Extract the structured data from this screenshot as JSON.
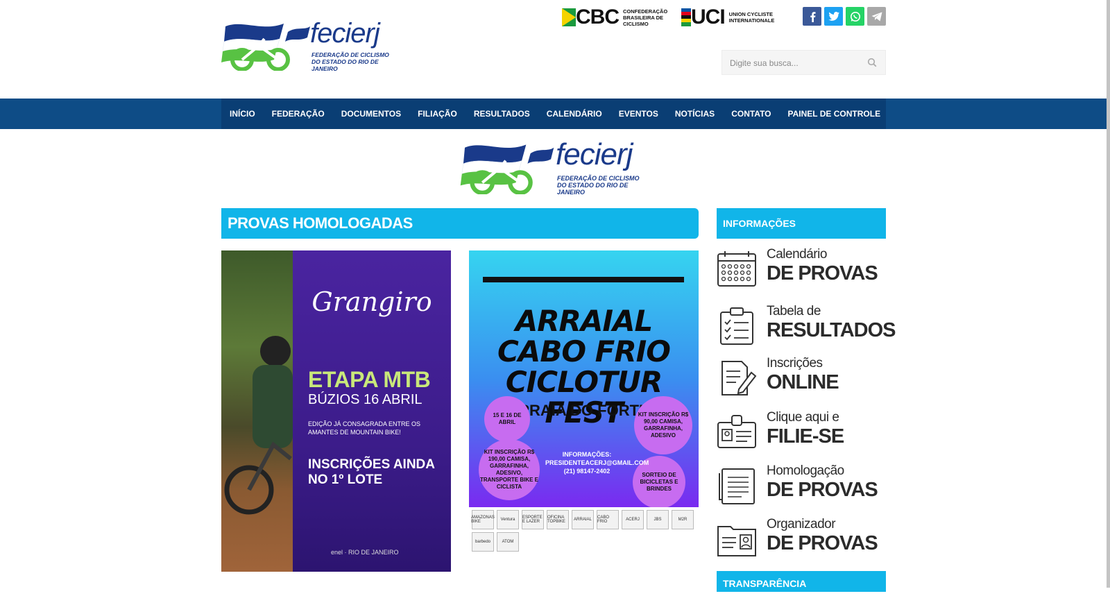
{
  "header": {
    "logo_name": "fecierj",
    "logo_subtitle": "FEDERAÇÃO DE CICLISMO DO ESTADO DO RIO DE JANEIRO",
    "partners": [
      {
        "mark": "CBC",
        "sub": "CONFEDERAÇÃO BRASILEIRA DE CICLISMO"
      },
      {
        "mark": "UCI",
        "sub": "UNION CYCLISTE INTERNATIONALE"
      }
    ],
    "social": [
      {
        "name": "facebook",
        "color": "#3b5998",
        "glyph": "f"
      },
      {
        "name": "twitter",
        "color": "#1da1f2",
        "glyph": "t"
      },
      {
        "name": "whatsapp",
        "color": "#25d366",
        "glyph": "w"
      },
      {
        "name": "telegram",
        "color": "#a8a8a8",
        "glyph": "tg"
      }
    ],
    "search": {
      "placeholder": "Digite sua busca..."
    }
  },
  "nav": {
    "items": [
      "INÍCIO",
      "FEDERAÇÃO",
      "DOCUMENTOS",
      "FILIAÇÃO",
      "RESULTADOS",
      "CALENDÁRIO",
      "EVENTOS",
      "NOTÍCIAS",
      "CONTATO",
      "PAINEL DE CONTROLE"
    ]
  },
  "center_logo": {
    "name": "fecierj",
    "subtitle": "FEDERAÇÃO DE CICLISMO DO ESTADO DO RIO DE JANEIRO"
  },
  "main": {
    "heading": "PROVAS HOMOLOGADAS",
    "posters": [
      {
        "brand": "Grangiro",
        "title": "ETAPA MTB",
        "subtitle": "BÚZIOS 16 ABRIL",
        "note": "EDIÇÃO JÁ CONSAGRADA ENTRE OS AMANTES DE MOUNTAIN BIKE!",
        "cta": "INSCRIÇÕES AINDA NO 1º LOTE",
        "footer": "enel · RIO DE JANEIRO"
      },
      {
        "title": "ARRAIAL CABO FRIO CICLOTUR FEST",
        "place": "PRAIA DO FORTE",
        "date": "15 E 16 DE ABRIL",
        "kit1": "KIT INSCRIÇÃO R$ 90,00 CAMISA, GARRAFINHA, ADESIVO",
        "kit2": "KIT INSCRIÇÃO R$ 190,00 CAMISA, GARRAFINHA, ADESIVO, TRANSPORTE BIKE E CICLISTA",
        "info_title": "INFORMAÇÕES:",
        "info_email": "PRESIDENTEACERJ@GMAIL.COM",
        "info_phone": "(21) 98147-2402",
        "raffle": "SORTEIO DE BICICLETAS E BRINDES",
        "sponsors": [
          "AMAZONAS BIKE",
          "Ventura",
          "ESPORTE E LAZER",
          "OFICINA TOPBIKE",
          "ARRAIAL",
          "CABO FRIO",
          "ACERJ",
          "JBS",
          "M2R",
          "barbedo",
          "ATOM"
        ]
      }
    ]
  },
  "sidebar": {
    "heading": "INFORMAÇÕES",
    "items": [
      {
        "line1": "Calendário",
        "line2": "DE PROVAS",
        "icon": "calendar-icon"
      },
      {
        "line1": "Tabela de",
        "line2": "RESULTADOS",
        "icon": "clipboard-check-icon"
      },
      {
        "line1": "Inscrições",
        "line2": "ONLINE",
        "icon": "document-edit-icon"
      },
      {
        "line1": "Clique aqui e",
        "line2": "FILIE-SE",
        "icon": "id-badge-icon"
      },
      {
        "line1": "Homologação",
        "line2": "DE PROVAS",
        "icon": "document-lines-icon"
      },
      {
        "line1": "Organizador",
        "line2": "DE PROVAS",
        "icon": "folder-user-icon"
      }
    ],
    "transparency_heading": "TRANSPARÊNCIA"
  }
}
